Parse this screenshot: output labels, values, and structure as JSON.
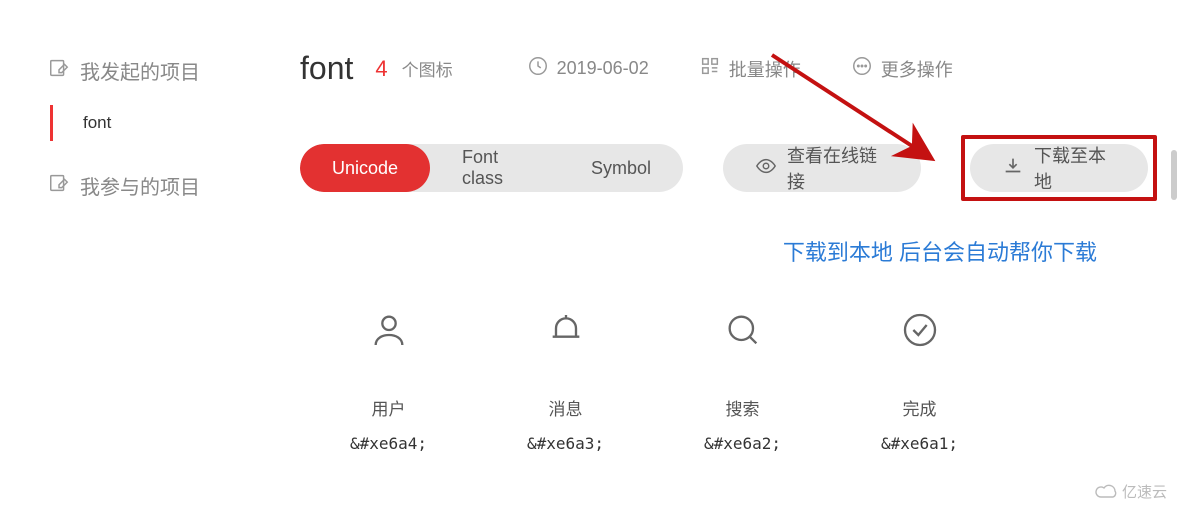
{
  "sidebar": {
    "section_started": "我发起的项目",
    "items": [
      {
        "label": "font"
      }
    ],
    "section_joined": "我参与的项目"
  },
  "header": {
    "title": "font",
    "count": "4",
    "count_suffix": "个图标",
    "date": "2019-06-02",
    "batch_label": "批量操作",
    "more_label": "更多操作"
  },
  "tabs": {
    "unicode": "Unicode",
    "fontclass": "Font class",
    "symbol": "Symbol"
  },
  "actions": {
    "view_link": "查看在线链接",
    "download": "下载至本地"
  },
  "annotation": "下载到本地 后台会自动帮你下载",
  "icons": [
    {
      "name": "用户",
      "code": "&#xe6a4;",
      "glyph": "user-icon"
    },
    {
      "name": "消息",
      "code": "&#xe6a3;",
      "glyph": "bell-icon"
    },
    {
      "name": "搜索",
      "code": "&#xe6a2;",
      "glyph": "search-icon"
    },
    {
      "name": "完成",
      "code": "&#xe6a1;",
      "glyph": "check-circle-icon"
    }
  ],
  "watermark": "亿速云"
}
